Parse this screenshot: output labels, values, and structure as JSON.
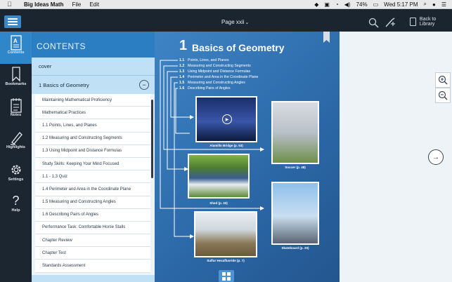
{
  "menubar": {
    "apple": "",
    "app_name": "Big Ideas Math",
    "menus": [
      "File",
      "Edit"
    ],
    "battery": "74%",
    "clock": "Wed 5:17 PM"
  },
  "toolbar": {
    "page_label": "Page xxii",
    "back_label": "Back to Library"
  },
  "rail": {
    "items": [
      {
        "label": "Contents",
        "icon": "contents-icon"
      },
      {
        "label": "Bookmarks",
        "icon": "bookmark-icon"
      },
      {
        "label": "Notes",
        "icon": "notes-icon"
      },
      {
        "label": "Highlights",
        "icon": "highlighter-icon"
      },
      {
        "label": "Settings",
        "icon": "gear-icon"
      },
      {
        "label": "Help",
        "icon": "help-icon"
      }
    ]
  },
  "contents": {
    "title": "CONTENTS",
    "cover": "cover",
    "chapter": "1 Basics of Geometry",
    "collapse": "−",
    "items": [
      "Maintaining Mathematical Proficiency",
      "Mathematical Practices",
      "1.1 Points, Lines, and Planes",
      "1.2 Measuring and Constructing Segments",
      "1.3 Using Midpoint and Distance Formulas",
      "Study Skills: Keeping Your Mind Focused",
      "1.1 - 1.3 Quiz",
      "1.4 Perimeter and Area in the Coordinate Plane",
      "1.5 Measuring and Constructing Angles",
      "1.6 Describing Pairs of Angles",
      "Performance Task: Comfortable Horse Stalls",
      "Chapter Review",
      "Chapter Test",
      "Standards Assessment"
    ]
  },
  "book": {
    "chapter_number": "1",
    "chapter_title": "Basics of Geometry",
    "sections": [
      {
        "num": "1.1",
        "title": "Points, Lines, and Planes"
      },
      {
        "num": "1.2",
        "title": "Measuring and Constructing Segments"
      },
      {
        "num": "1.3",
        "title": "Using Midpoint and Distance Formulas"
      },
      {
        "num": "1.4",
        "title": "Perimeter and Area in the Coordinate Plane"
      },
      {
        "num": "1.5",
        "title": "Measuring and Constructing Angles"
      },
      {
        "num": "1.6",
        "title": "Describing Pairs of Angles"
      }
    ],
    "captions": {
      "bridge": "Alamillo Bridge (p. 53)",
      "soccer": "Soccer (p. 48)",
      "shed": "Shed (p. 33)",
      "skateboard": "Skateboard (p. 20)",
      "sulfur": "Sulfur Hexafluoride (p. 7)"
    }
  },
  "colors": {
    "accent": "#2f86c8",
    "page_blue": "#2b67a6",
    "rail_bg": "#1c2630"
  }
}
